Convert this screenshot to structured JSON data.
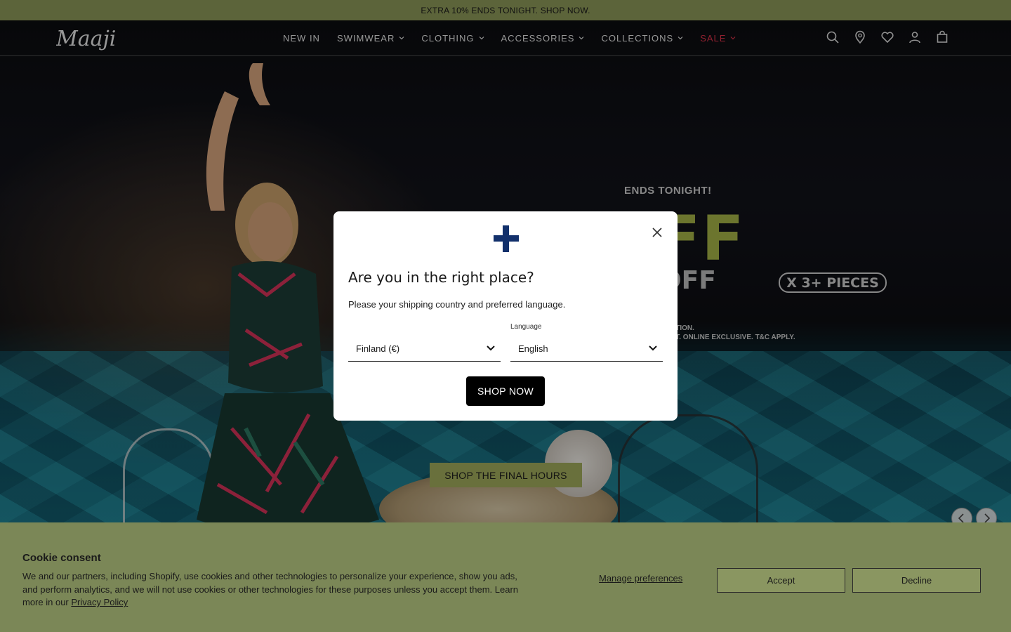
{
  "announcement": {
    "text": "EXTRA 10% ENDS TONIGHT. SHOP NOW."
  },
  "brand": {
    "logo_text": "Maaji"
  },
  "nav": {
    "items": [
      {
        "label": "NEW IN",
        "has_dropdown": false
      },
      {
        "label": "SWIMWEAR",
        "has_dropdown": true
      },
      {
        "label": "CLOTHING",
        "has_dropdown": true
      },
      {
        "label": "ACCESSORIES",
        "has_dropdown": true
      },
      {
        "label": "COLLECTIONS",
        "has_dropdown": true
      },
      {
        "label": "SALE",
        "has_dropdown": true
      }
    ],
    "sale_color": "#e0334a"
  },
  "header_icons": [
    "search-icon",
    "store-locator-icon",
    "wishlist-icon",
    "account-icon",
    "bag-icon"
  ],
  "hero": {
    "ends": "ENDS TONIGHT!",
    "headline_visible": "OFF",
    "sub_off_visible": "OFF",
    "pieces": "X 3+ PIECES",
    "fine_print_1": "CTION.",
    "fine_print_2": "CT. ONLINE EXCLUSIVE. T&C APPLY.",
    "cta": "SHOP THE FINAL HOURS",
    "accent_color": "#a6b447"
  },
  "modal": {
    "flag": "finland-flag",
    "title": "Are you in the right place?",
    "subtitle": "Please your shipping country and preferred language.",
    "language_label": "Language",
    "country_value": "Finland (€)",
    "language_value": "English",
    "button": "SHOP NOW"
  },
  "cookie": {
    "title": "Cookie consent",
    "text": "We and our partners, including Shopify, use cookies and other technologies to personalize your experience, show you ads, and perform analytics, and we will not use cookies or other technologies for these purposes unless you accept them. Learn more in our",
    "link": "Privacy Policy",
    "manage": "Manage preferences",
    "accept": "Accept",
    "decline": "Decline",
    "bg_color": "#7b8757"
  }
}
